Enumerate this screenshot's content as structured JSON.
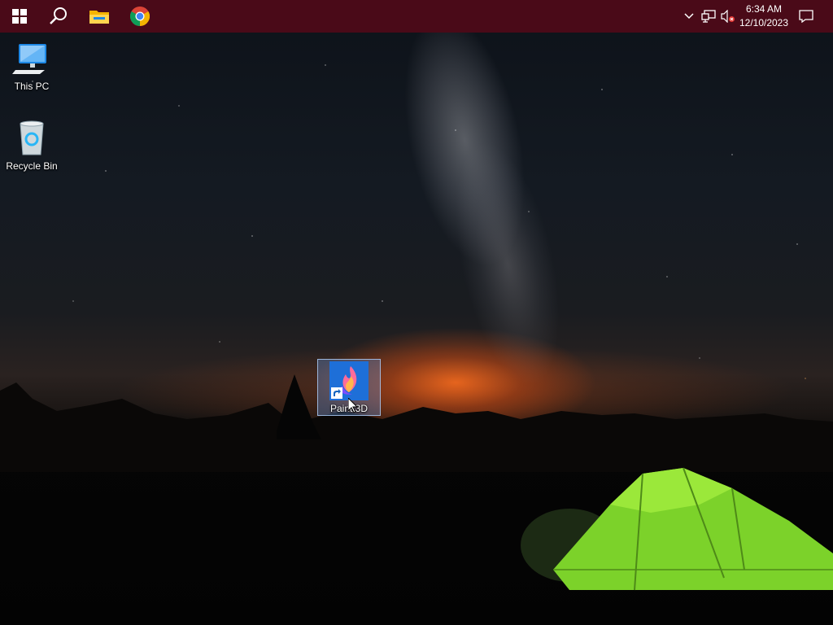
{
  "taskbar": {
    "buttons": [
      {
        "name": "start",
        "icon": "windows-logo-icon"
      },
      {
        "name": "search",
        "icon": "search-icon"
      },
      {
        "name": "file-explorer",
        "icon": "folder-icon"
      },
      {
        "name": "chrome",
        "icon": "chrome-icon"
      }
    ],
    "tray": {
      "icons": [
        "chevron-up-icon",
        "network-icon",
        "volume-muted-icon"
      ],
      "time": "6:34 AM",
      "date": "12/10/2023",
      "notification_icon": "notification-icon"
    },
    "color": "#4a0a18"
  },
  "desktop": {
    "icons": [
      {
        "label": "This PC",
        "icon": "computer-icon"
      },
      {
        "label": "Recycle Bin",
        "icon": "recycle-bin-icon"
      },
      {
        "label": "Paint 3D",
        "icon": "paint3d-icon",
        "shortcut": true,
        "selected": true
      }
    ]
  }
}
